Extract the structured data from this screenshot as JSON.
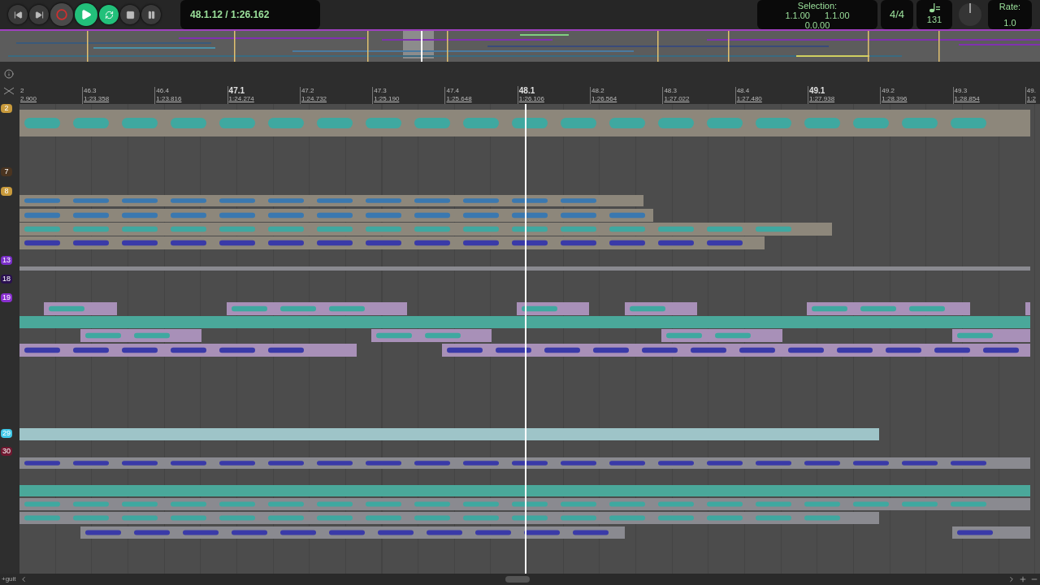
{
  "transport": {
    "buttons": [
      {
        "kind": "prev",
        "on": false
      },
      {
        "kind": "next",
        "on": false
      },
      {
        "kind": "record",
        "on": false
      },
      {
        "kind": "play",
        "on": true
      },
      {
        "kind": "repeat",
        "on": true
      },
      {
        "kind": "stop",
        "on": false
      },
      {
        "kind": "pause",
        "on": false
      }
    ],
    "position": "48.1.12 / 1:26.162",
    "selection": {
      "label": "Selection:",
      "start": "1.1.00",
      "end": "1.1.00",
      "length": "0.0.00"
    },
    "time_signature": "4/4",
    "tempo": "131",
    "rate": {
      "label": "Rate:",
      "value": "1.0"
    }
  },
  "ruler": [
    {
      "bar": "2",
      "time": "2.900",
      "major": false
    },
    {
      "bar": "46.3",
      "time": "1:23.358",
      "major": false
    },
    {
      "bar": "46.4",
      "time": "1:23.816",
      "major": false
    },
    {
      "bar": "47.1",
      "time": "1:24.274",
      "major": true
    },
    {
      "bar": "47.2",
      "time": "1:24.732",
      "major": false
    },
    {
      "bar": "47.3",
      "time": "1:25.190",
      "major": false
    },
    {
      "bar": "47.4",
      "time": "1:25.648",
      "major": false
    },
    {
      "bar": "48.1",
      "time": "1:26.106",
      "major": true
    },
    {
      "bar": "48.2",
      "time": "1:26.564",
      "major": false
    },
    {
      "bar": "48.3",
      "time": "1:27.022",
      "major": false
    },
    {
      "bar": "48.4",
      "time": "1:27.480",
      "major": false
    },
    {
      "bar": "49.1",
      "time": "1:27.938",
      "major": true
    },
    {
      "bar": "49.2",
      "time": "1:28.396",
      "major": false
    },
    {
      "bar": "49.3",
      "time": "1:28.854",
      "major": false
    },
    {
      "bar": "49.",
      "time": "1:2",
      "major": false
    }
  ],
  "tracks": [
    {
      "number": "2",
      "color": "#c89a3c"
    },
    {
      "number": "7",
      "color": "#4a3420"
    },
    {
      "number": "8",
      "color": "#c89a3c"
    },
    {
      "number": "13",
      "color": "#7a2fc8"
    },
    {
      "number": "18",
      "color": "#2a1050"
    },
    {
      "number": "19",
      "color": "#8a30d0"
    },
    {
      "number": "29",
      "color": "#40c8e8"
    },
    {
      "number": "30",
      "color": "#701830"
    }
  ],
  "footer": {
    "track_name": "+guit"
  }
}
